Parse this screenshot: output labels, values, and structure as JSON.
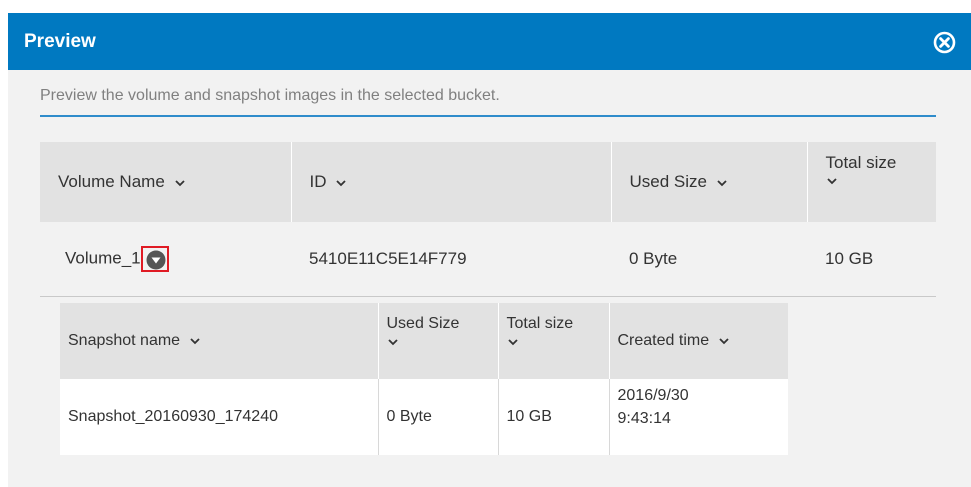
{
  "dialog": {
    "title": "Preview",
    "close_icon": "close-circle-icon",
    "description": "Preview the volume and snapshot images in the selected bucket."
  },
  "colors": {
    "titlebar": "#0079c1",
    "dialog_background": "#f2f2f2",
    "header_background": "#e2e2e2",
    "description_underline": "#2f8ccb",
    "highlight_border": "#e01b24",
    "expand_icon": "#555555"
  },
  "volume_table": {
    "columns": [
      {
        "label": "Volume Name",
        "sort_icon": "chevron-down-icon"
      },
      {
        "label": "ID",
        "sort_icon": "chevron-down-icon"
      },
      {
        "label": "Used Size",
        "sort_icon": "chevron-down-icon"
      },
      {
        "label": "Total size",
        "sort_icon": "chevron-down-icon"
      }
    ],
    "rows": [
      {
        "volume_name": "Volume_1",
        "expand_icon": "expand-down-circle-icon",
        "id": "5410E11C5E14F779",
        "used_size": "0 Byte",
        "total_size": "10 GB"
      }
    ]
  },
  "snapshot_table": {
    "columns": [
      {
        "label": "Snapshot name",
        "sort_icon": "chevron-down-icon"
      },
      {
        "label": "Used Size",
        "sort_icon": "chevron-down-icon"
      },
      {
        "label": "Total size",
        "sort_icon": "chevron-down-icon"
      },
      {
        "label": "Created time",
        "sort_icon": "chevron-down-icon"
      }
    ],
    "rows": [
      {
        "snapshot_name": "Snapshot_20160930_174240",
        "used_size": "0 Byte",
        "total_size": "10 GB",
        "created_date": "2016/9/30",
        "created_time": "9:43:14"
      }
    ]
  }
}
